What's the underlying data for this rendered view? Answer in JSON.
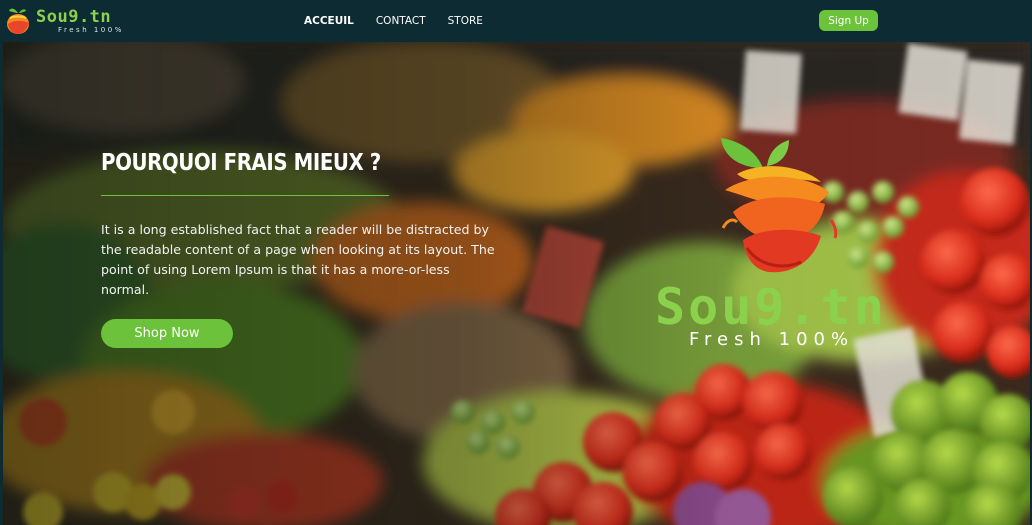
{
  "brand": {
    "name": "Sou9.tn",
    "tagline": "Fresh 100%"
  },
  "nav": {
    "links": [
      {
        "label": "ACCEUIL",
        "active": true
      },
      {
        "label": "CONTACT",
        "active": false
      },
      {
        "label": "STORE",
        "active": false
      }
    ],
    "signup_label": "Sign Up"
  },
  "hero": {
    "title": "POURQUOI FRAIS MIEUX ?",
    "text": "It is a long established fact that a reader will be distracted by the readable content of a page when looking at its layout. The point of using Lorem Ipsum is that it has a more-or-less normal.",
    "button_label": "Shop Now",
    "logo_name": "Sou9.tn",
    "logo_tagline": "Fresh 100%"
  },
  "colors": {
    "navbar": "#0d2b33",
    "accent": "#6cc23a",
    "brand_green": "#8cd14c"
  }
}
